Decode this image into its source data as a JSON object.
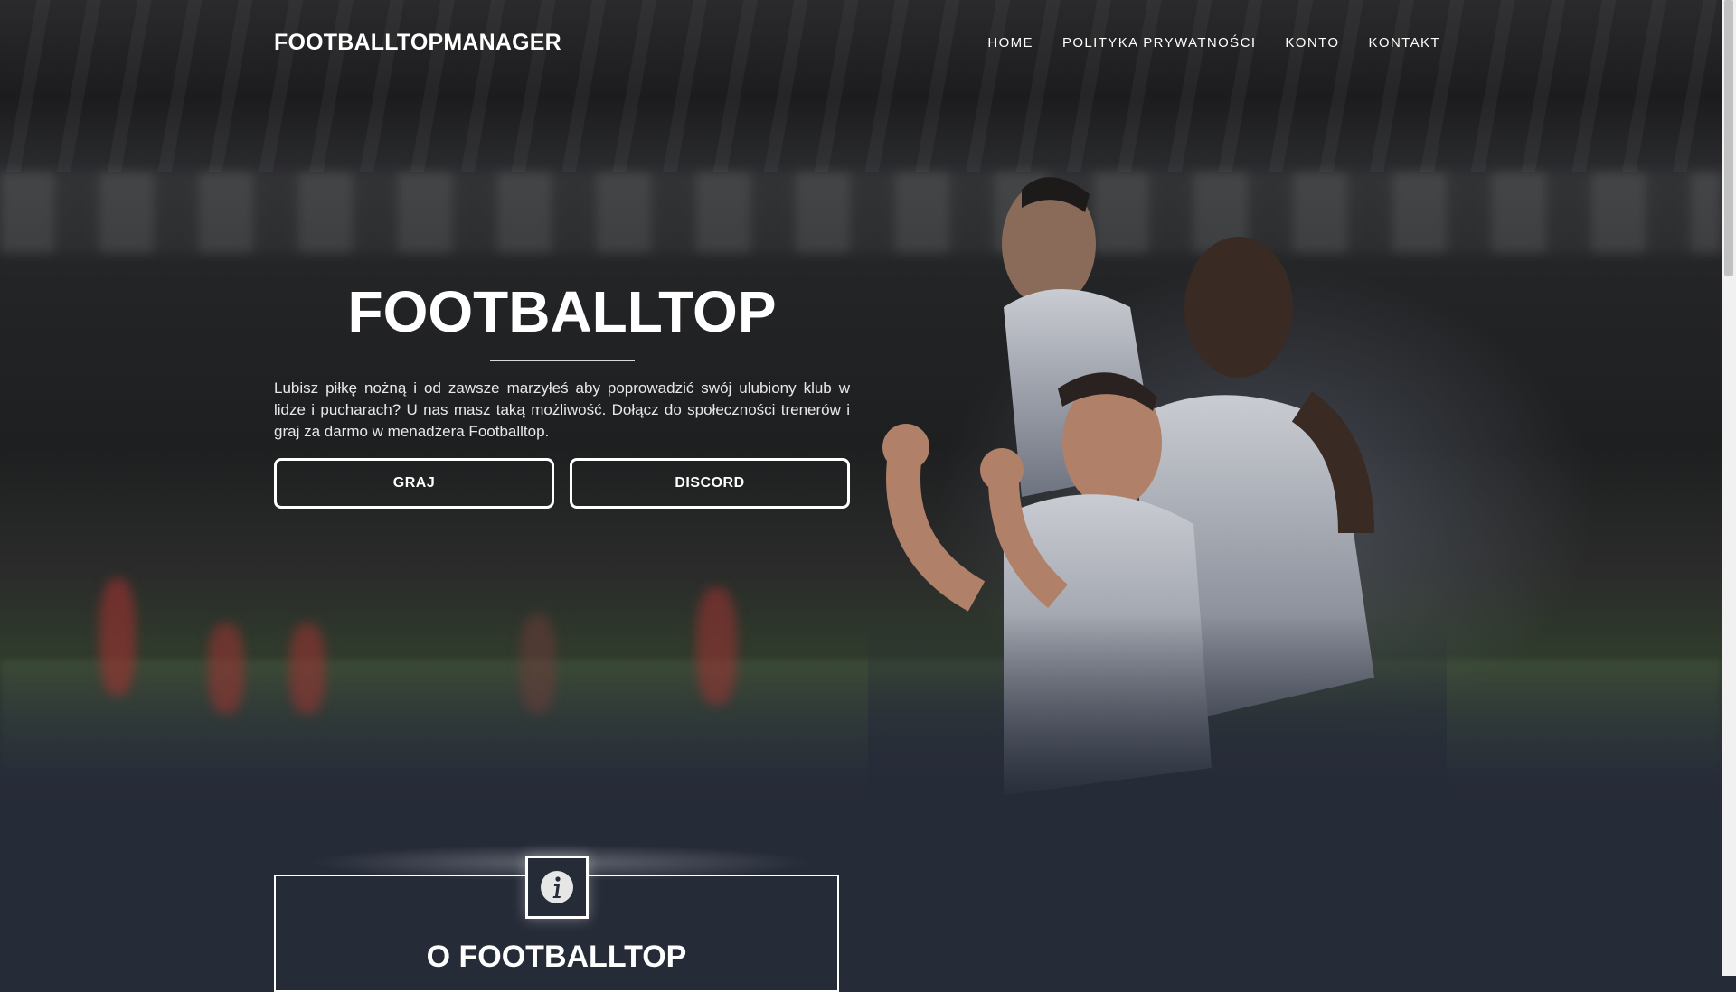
{
  "navbar": {
    "brand": "FOOTBALLTOPMANAGER",
    "links": [
      "HOME",
      "POLITYKA PRYWATNOŚCI",
      "KONTO",
      "KONTAKT"
    ]
  },
  "hero": {
    "title": "FOOTBALLTOP",
    "description": "Lubisz piłkę nożną i od zawsze marzyłeś aby poprowadzić swój ulubiony klub w lidze i pucharach? U nas masz taką możliwość. Dołącz do społeczności trenerów i graj za darmo w menadżera Footballtop.",
    "buttons": {
      "play": "GRAJ",
      "discord": "DISCORD"
    },
    "background_icon": "stadium-players-image"
  },
  "about": {
    "icon": "info-icon",
    "title": "O FOOTBALLTOP"
  },
  "colors": {
    "page_bg": "#262b38",
    "text": "#ffffff",
    "scrollbar_track": "#f1f1f1",
    "scrollbar_thumb": "#c1c1c1"
  }
}
